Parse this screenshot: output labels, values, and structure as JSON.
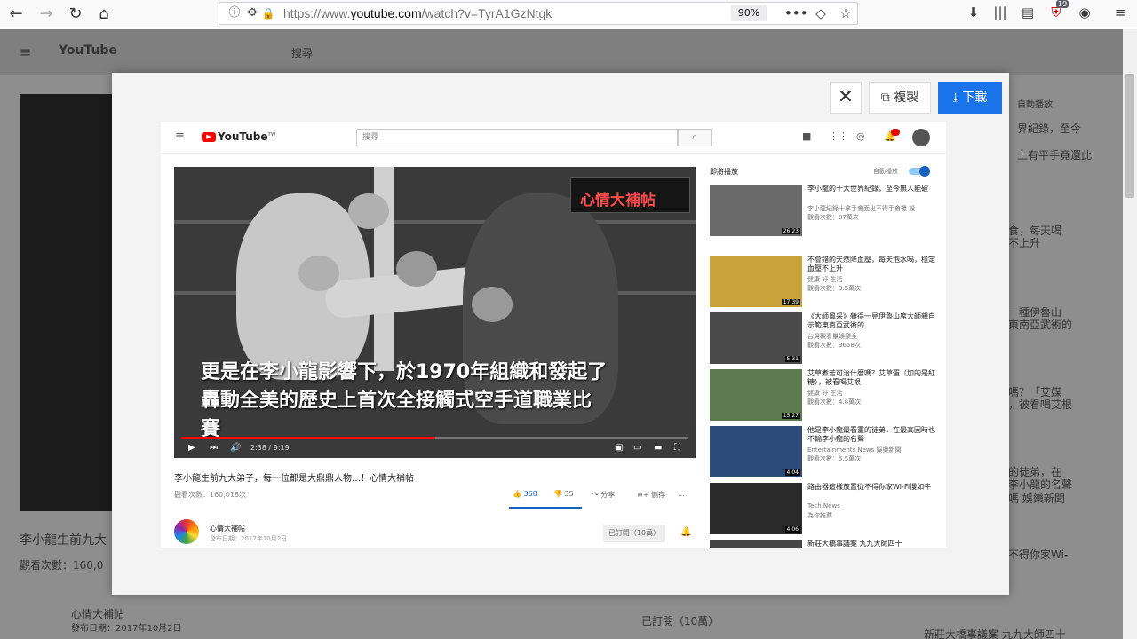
{
  "browser": {
    "url_prefix": "https://www.",
    "url_host": "youtube.com",
    "url_path": "/watch?v=TyrA1GzNtgk",
    "zoom": "90%",
    "addon_badge": "19"
  },
  "background": {
    "logo": "YouTube",
    "search_placeholder": "搜尋",
    "video_title": "李小龍生前九大",
    "views": "觀看次數：160,0",
    "channel": "心情大補帖",
    "channel_date": "發布日期：2017年10月2日",
    "subscribe": "已訂閱（10萬）",
    "autoplay": "自動播放",
    "side_snippets": [
      "界紀錄，至今",
      "上有平手竟還此",
      "食，每天喝",
      "不上升",
      "一種伊魯山",
      "東南亞武術的",
      "嗎？「艾媒",
      "，被看喝艾根",
      "的徒弟，在",
      "李小龍的名聲",
      "嗎 娛樂新聞",
      "不得你家Wi-",
      "新莊大橋事議案 九九大師四十"
    ]
  },
  "modal": {
    "close_label": "✕",
    "copy_label": "複製",
    "download_label": "下載"
  },
  "yt": {
    "logo": "YouTube",
    "logo_tm": "TW",
    "search_placeholder": "搜尋",
    "banner": "心情大補帖",
    "subtitle_line1": "更是在李小龍影響下，於1970年組織和發起了",
    "subtitle_line2": "轟動全美的歷史上首次全接觸式空手道職業比",
    "subtitle_line3": "賽",
    "time": "2:38 / 9:19",
    "progress": 0.5,
    "video_title": "李小龍生前九大弟子，每一位都是大鼎鼎人物…！心情大補帖",
    "views": "觀看次數：160,018次",
    "likes": "368",
    "dislikes": "35",
    "share": "分享",
    "save": "儲存",
    "more": "…",
    "channel": "心情大補帖",
    "channel_date": "發布日期：2017年10月2日",
    "subscribe": "已訂閱（10萬）",
    "up_next": "即將播放",
    "autoplay": "自動播放"
  },
  "recommendations": [
    {
      "title": "李小龍的十大世界紀錄，至今無人能破",
      "channel": "李小龍紀錄十拿手會面出不得手會覆 設",
      "meta": "觀看次數：87萬次",
      "duration": "26:23"
    },
    {
      "title": "不會錯的天然降血壓，每天泡水喝，穩定血壓不上升",
      "channel": "健康 好 生活",
      "meta": "觀看次數：3.5萬次",
      "duration": "17:39"
    },
    {
      "title": "《大師風采》雜得一見伊魯山席大師親自示範東南亞武術的",
      "channel": "台灣觀看量娛樂全",
      "meta": "觀看次數：9658次",
      "duration": "5:31"
    },
    {
      "title": "艾草煮苦可治什麼嗎？艾草蛋（加的是紅糖），被看喝艾根",
      "channel": "健康 好 生活",
      "meta": "觀看次數：4.8萬次",
      "duration": "15:27"
    },
    {
      "title": "他是李小龍最看重的徒弟，在最高因時也不輸李小龍的名聲",
      "channel": "Entertainments News 娛樂新聞",
      "meta": "觀看次數：5.5萬次",
      "duration": "4:04"
    },
    {
      "title": "路由器這樣放置從不得你家Wi-Fi慢如牛",
      "channel": "Tech News",
      "meta": "為你推薦",
      "duration": "4:06"
    },
    {
      "title": "新莊大橋事議案 九九大師四十",
      "channel": "",
      "meta": "",
      "duration": ""
    }
  ]
}
